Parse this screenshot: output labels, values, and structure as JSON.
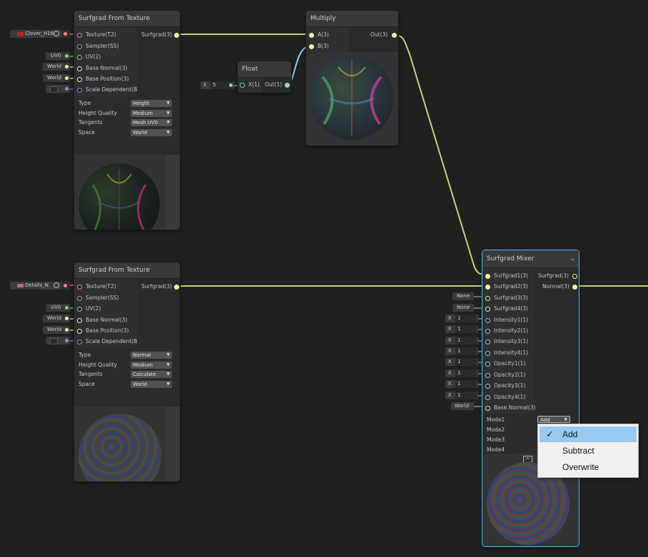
{
  "colors": {
    "background": "#202020",
    "wire_vec3": "#c9d17a",
    "wire_float": "#84d4e6",
    "texture_port": "#ff8080",
    "sampler_port": "#9e9e9e",
    "uv_port": "#7ed36c",
    "vec3_port": "#f1f4a0",
    "bool_port": "#9a87dc",
    "selection": "#44c0ff",
    "menu_highlight": "#99c9ef"
  },
  "nodes": {
    "sfg1": {
      "title": "Surfgrad From Texture",
      "inputs": [
        "Texture(T2)",
        "Sampler(SS)",
        "UV(2)",
        "Base Normal(3)",
        "Base Position(3)",
        "Scale Dependent(B)"
      ],
      "output": "Surfgrad(3)",
      "props": [
        {
          "label": "Type",
          "value": "Height"
        },
        {
          "label": "Height Quality",
          "value": "Medium"
        },
        {
          "label": "Tangents",
          "value": "Mesh UV0"
        },
        {
          "label": "Space",
          "value": "World"
        }
      ],
      "external": {
        "texture": "Clover_H16",
        "uv": "UV0",
        "base_normal": "World",
        "base_position": "World"
      }
    },
    "sfg2": {
      "title": "Surfgrad From Texture",
      "inputs": [
        "Texture(T2)",
        "Sampler(SS)",
        "UV(2)",
        "Base Normal(3)",
        "Base Position(3)",
        "Scale Dependent(B)"
      ],
      "output": "Surfgrad(3)",
      "props": [
        {
          "label": "Type",
          "value": "Normal"
        },
        {
          "label": "Height Quality",
          "value": "Medium"
        },
        {
          "label": "Tangents",
          "value": "Calculate"
        },
        {
          "label": "Space",
          "value": "World"
        }
      ],
      "external": {
        "texture": "Details_N",
        "uv": "UV0",
        "base_normal": "World",
        "base_position": "World"
      }
    },
    "float": {
      "title": "Float",
      "input": "X(1)",
      "output": "Out(1)",
      "x_label": "X",
      "x_value": "5"
    },
    "multiply": {
      "title": "Multiply",
      "inputs": [
        "A(3)",
        "B(3)"
      ],
      "output": "Out(3)"
    },
    "mixer": {
      "title": "Surfgrad Mixer",
      "collapse_icon": "chevron-down-icon",
      "inputs": [
        "Surfgrad1(3)",
        "Surfgrad2(3)",
        "Surfgrad3(3)",
        "Surfgrad4(3)",
        "Intensity1(1)",
        "Intensity2(1)",
        "Intensity3(1)",
        "Intensity4(1)",
        "Opacity1(1)",
        "Opacity2(1)",
        "Opacity3(1)",
        "Opacity4(1)",
        "Base Normal(3)"
      ],
      "outputs": [
        "Surfgrad(3)",
        "Normal(3)"
      ],
      "external": {
        "s3": "None",
        "s4": "None",
        "x_label": "X",
        "one": "1",
        "base_normal": "World"
      },
      "modes": [
        "Mode1",
        "Mode2",
        "Mode3",
        "Mode4"
      ],
      "mode1_value": "Add",
      "preview_toggle": "^"
    }
  },
  "dropdown_menu": {
    "items": [
      "Add",
      "Subtract",
      "Overwrite"
    ],
    "selected": "Add",
    "check_glyph": "✓"
  }
}
